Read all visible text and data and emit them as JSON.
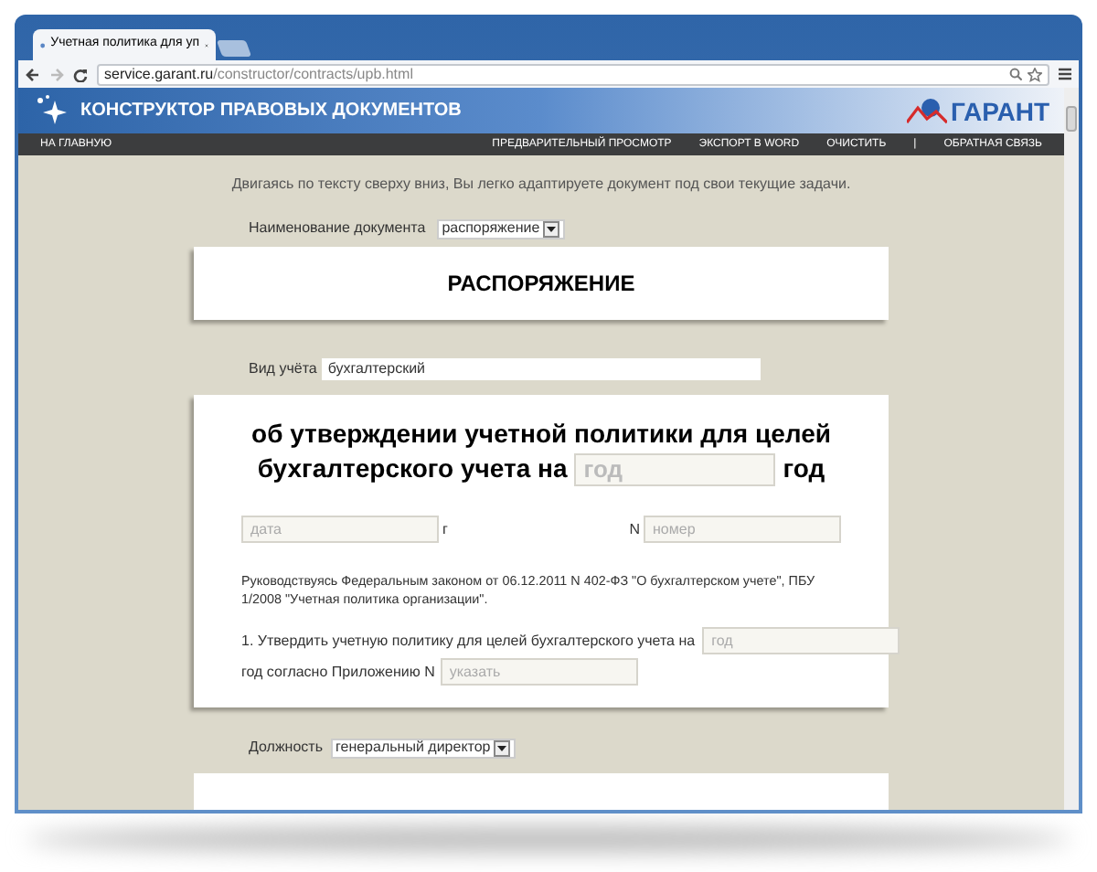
{
  "browser": {
    "tab_title": "Учетная политика для уп",
    "url_host": "service.garant.ru",
    "url_path": "/constructor/contracts/upb.html"
  },
  "header": {
    "title": "КОНСТРУКТОР ПРАВОВЫХ ДОКУМЕНТОВ",
    "logo_text": "ГАРАНТ"
  },
  "nav": {
    "left": "НА ГЛАВНУЮ",
    "right": [
      "ПРЕДВАРИТЕЛЬНЫЙ ПРОСМОТР",
      "ЭКСПОРТ В WORD",
      "ОЧИСТИТЬ",
      "|",
      "ОБРАТНАЯ СВЯЗЬ"
    ]
  },
  "intro": "Двигаясь по тексту сверху вниз, Вы легко адаптируете документ под свои текущие задачи.",
  "document_name": {
    "label": "Наименование документа",
    "value": "распоряжение"
  },
  "heading": "РАСПОРЯЖЕНИЕ",
  "account_type": {
    "label": "Вид учёта",
    "value": "бухгалтерский"
  },
  "order": {
    "title_line1": "об утверждении учетной политики для целей",
    "title_line2": "бухгалтерского учета на",
    "year_placeholder": "год",
    "title_end": "год",
    "date_placeholder": "дата",
    "date_suffix": "г",
    "number_label": "N",
    "number_placeholder": "номер",
    "basis": "Руководствуясь Федеральным законом от 06.12.2011 N 402-ФЗ \"О бухгалтерском учете\", ПБУ 1/2008 \"Учетная политика организации\".",
    "clause_start": "1. Утвердить учетную политику для целей бухгалтерского учета на",
    "clause_year_placeholder": "год",
    "clause_end": "год согласно Приложению N",
    "appendix_placeholder": "указать"
  },
  "position": {
    "label": "Должность",
    "value": "генеральный директор"
  }
}
